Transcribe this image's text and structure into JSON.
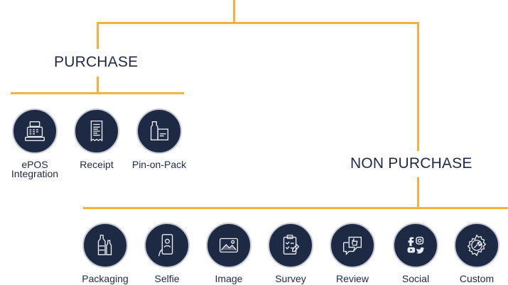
{
  "colors": {
    "connector": "#f2b23b",
    "circle_fill": "#1e2a44",
    "circle_ring": "#c7ccd6",
    "text": "#1e2a44"
  },
  "purchase": {
    "title": "PURCHASE",
    "items": [
      {
        "label": "ePOS\nIntegration",
        "icon": "cash-register-icon"
      },
      {
        "label": "Receipt",
        "icon": "receipt-icon"
      },
      {
        "label": "Pin-on-Pack",
        "icon": "product-pack-icon"
      }
    ]
  },
  "non_purchase": {
    "title": "NON PURCHASE",
    "items": [
      {
        "label": "Packaging",
        "icon": "bottles-icon"
      },
      {
        "label": "Selfie",
        "icon": "phone-selfie-icon"
      },
      {
        "label": "Image",
        "icon": "image-icon"
      },
      {
        "label": "Survey",
        "icon": "clipboard-checklist-icon"
      },
      {
        "label": "Review",
        "icon": "thumbs-up-chat-icon"
      },
      {
        "label": "Social",
        "icon": "social-media-icon"
      },
      {
        "label": "Custom",
        "icon": "gear-wrench-icon"
      }
    ]
  }
}
